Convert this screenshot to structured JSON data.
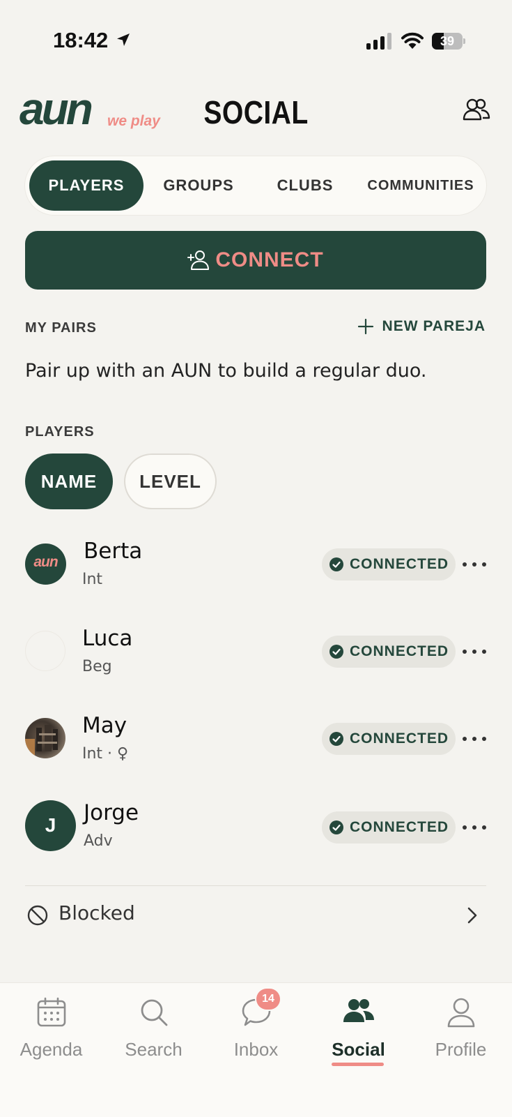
{
  "status_bar": {
    "time": "18:42",
    "battery": "39",
    "battery_level": 0.39
  },
  "header": {
    "logo_main": "aun",
    "logo_sub": "we play",
    "title": "SOCIAL"
  },
  "tabs": [
    {
      "label": "PLAYERS",
      "active": true
    },
    {
      "label": "GROUPS",
      "active": false
    },
    {
      "label": "CLUBS",
      "active": false
    },
    {
      "label": "COMMUNITIES",
      "active": false
    }
  ],
  "connect_button": {
    "label": "CONNECT",
    "icon": "add-person-icon"
  },
  "pairs": {
    "section_label": "MY PAIRS",
    "new_label": "NEW PAREJA",
    "description": "Pair up with an AUN to build a regular duo."
  },
  "players": {
    "section_label": "PLAYERS",
    "sort": [
      {
        "label": "NAME",
        "active": true
      },
      {
        "label": "LEVEL",
        "active": false
      }
    ],
    "list": [
      {
        "name": "Berta",
        "level": "Int",
        "status": "CONNECTED",
        "avatar": "aun"
      },
      {
        "name": "Luca",
        "level": "Beg",
        "status": "CONNECTED",
        "avatar": ""
      },
      {
        "name": "May",
        "level": "Int · ♀",
        "status": "CONNECTED",
        "avatar": "photo"
      },
      {
        "name": "Jorge",
        "level": "Adv",
        "status": "CONNECTED",
        "avatar": "J"
      }
    ]
  },
  "blocked": {
    "label": "Blocked"
  },
  "bottom_nav": {
    "items": [
      {
        "label": "Agenda",
        "icon": "calendar-icon",
        "active": false
      },
      {
        "label": "Search",
        "icon": "search-icon",
        "active": false
      },
      {
        "label": "Inbox",
        "icon": "chat-icon",
        "active": false,
        "badge": "14"
      },
      {
        "label": "Social",
        "icon": "people-icon",
        "active": true
      },
      {
        "label": "Profile",
        "icon": "user-icon",
        "active": false
      }
    ]
  },
  "colors": {
    "brand_green": "#24473b",
    "accent_pink": "#ef8c86",
    "background": "#f4f3ef"
  }
}
